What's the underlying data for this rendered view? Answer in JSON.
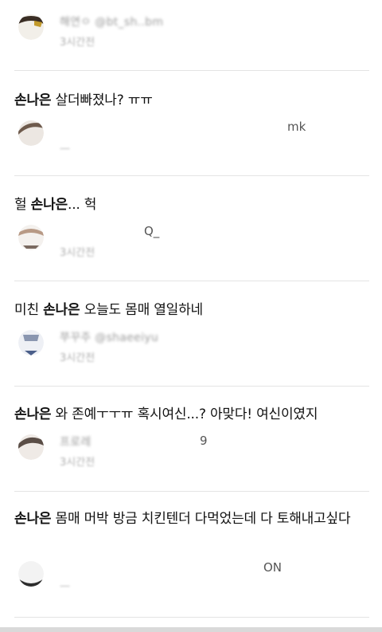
{
  "posts": [
    {
      "text_prefix": "",
      "keyword": "",
      "text_suffix": "",
      "author": "해연ㅇ @bt_sh..bm",
      "handle_tail": "bm",
      "time": "3시간전",
      "avatar_color": "#c29a2b"
    },
    {
      "text_prefix": "",
      "keyword": "손나은",
      "text_suffix": " 살더빠졌나? ㅠㅠ",
      "author": "",
      "handle_tail": "mk",
      "time": "",
      "avatar_color": "#6e5a4c"
    },
    {
      "text_prefix": "헐 ",
      "keyword": "손나은",
      "text_suffix": "... 헉",
      "author": "",
      "handle_tail": "Q_",
      "time": "3시간전",
      "avatar_color": "#b89a86"
    },
    {
      "text_prefix": "미친 ",
      "keyword": "손나은",
      "text_suffix": " 오늘도 몸매 열일하네",
      "author": "쭈꾸주 @shaeeiyu",
      "handle_tail": "",
      "time": "3시간전",
      "avatar_color": "#4b5f8a"
    },
    {
      "text_prefix": "",
      "keyword": "손나은",
      "text_suffix": " 와 존예ㅜㅜㅠ 혹시여신...? 아맞다! 여신이였지",
      "author": "프로레",
      "handle_tail": "9",
      "time": "3시간전",
      "avatar_color": "#5a4d46"
    },
    {
      "text_prefix": "",
      "keyword": "손나은",
      "text_suffix": " 몸매 머박 방금 치킨텐더 다먹었는데 다 토해내고싶다",
      "author": "",
      "handle_tail": "ON",
      "time": "",
      "avatar_color": "#2d2d2d"
    }
  ],
  "colors": {
    "background": "#ffffff",
    "divider": "#e4e4e4",
    "text": "#111111",
    "meta": "#8a8a8a"
  }
}
